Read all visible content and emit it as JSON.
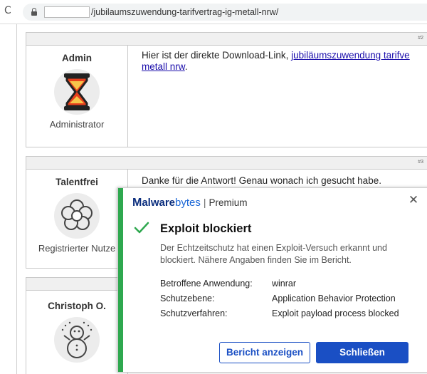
{
  "browser": {
    "reload_glyph": "C",
    "url": "/jubilaumszuwendung-tarifvertrag-ig-metall-nrw/"
  },
  "posts": [
    {
      "number": "#2",
      "author": "Admin",
      "role": "Administrator",
      "avatar_icon": "hourglass-icon",
      "text_prefix": "Hier ist der direkte Download-Link, ",
      "link_line1": "jubiläumszuwendung tarifve",
      "link_line2": "metall nrw",
      "text_suffix": "."
    },
    {
      "number": "#3",
      "author": "Talentfrei",
      "role": "Registrierter Nutze",
      "avatar_icon": "flower-icon",
      "text": "Danke für die Antwort! Genau wonach ich gesucht habe."
    },
    {
      "author": "Christoph O.",
      "avatar_icon": "snowman-icon"
    }
  ],
  "toast": {
    "brand_m": "M",
    "brand_mal": "alware",
    "brand_bytes": "bytes",
    "brand_sep": "|",
    "brand_tier": "Premium",
    "close_glyph": "✕",
    "title": "Exploit blockiert",
    "description": "Der Echtzeitschutz hat einen Exploit-Versuch erkannt und blockiert. Nähere Angaben finden Sie im Bericht.",
    "details": [
      {
        "label": "Betroffene Anwendung:",
        "value": "winrar"
      },
      {
        "label": "Schutzebene:",
        "value": "Application Behavior Protection"
      },
      {
        "label": "Schutzverfahren:",
        "value": "Exploit payload process blocked"
      }
    ],
    "report_button": "Bericht anzeigen",
    "close_button": "Schließen",
    "colors": {
      "accent": "#2fa84f",
      "primary": "#1a4fc4",
      "brand": "#0b2e7e"
    }
  }
}
